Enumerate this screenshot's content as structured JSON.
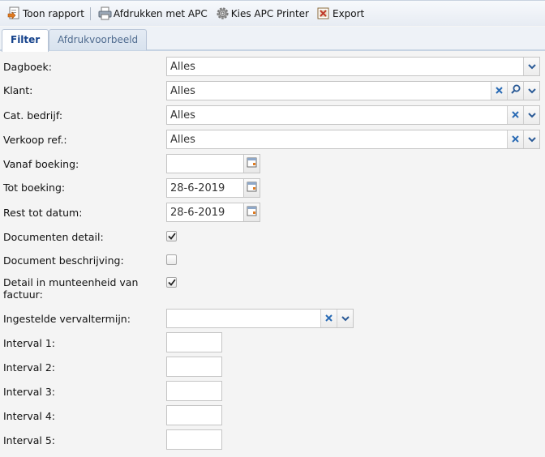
{
  "toolbar": {
    "toon_rapport": "Toon rapport",
    "afdrukken_apc": "Afdrukken met APC",
    "kies_printer": "Kies APC Printer",
    "export": "Export"
  },
  "tabs": {
    "filter": "Filter",
    "afdrukvoorbeeld": "Afdrukvoorbeeld"
  },
  "form": {
    "dagboek": {
      "label": "Dagboek:",
      "value": "Alles"
    },
    "klant": {
      "label": "Klant:",
      "value": "Alles"
    },
    "cat_bedrijf": {
      "label": "Cat. bedrijf:",
      "value": "Alles"
    },
    "verkoop_ref": {
      "label": "Verkoop ref.:",
      "value": "Alles"
    },
    "vanaf_boeking": {
      "label": "Vanaf boeking:",
      "value": ""
    },
    "tot_boeking": {
      "label": "Tot boeking:",
      "value": "28-6-2019"
    },
    "rest_tot_datum": {
      "label": "Rest tot datum:",
      "value": "28-6-2019"
    },
    "documenten_detail": {
      "label": "Documenten detail:",
      "checked": true
    },
    "document_beschrijving": {
      "label": "Document beschrijving:",
      "checked": false
    },
    "detail_munteenheid": {
      "label_line1": "Detail in munteenheid van",
      "label_line2": "factuur:",
      "checked": true
    },
    "vervaltermijn": {
      "label": "Ingestelde vervaltermijn:",
      "value": ""
    },
    "intervals": [
      {
        "label": "Interval 1:",
        "value": ""
      },
      {
        "label": "Interval 2:",
        "value": ""
      },
      {
        "label": "Interval 3:",
        "value": ""
      },
      {
        "label": "Interval 4:",
        "value": ""
      },
      {
        "label": "Interval 5:",
        "value": ""
      }
    ]
  },
  "icons": {
    "toon_rapport": "report-icon",
    "afdrukken_apc": "printer-icon",
    "kies_printer": "gear-icon",
    "export": "export-icon",
    "clear": "clear-x-icon",
    "dropdown": "chevron-down-icon",
    "search": "search-icon",
    "calendar": "calendar-icon",
    "check": "checkmark-icon"
  },
  "colors": {
    "accent": "#15428b",
    "clear_x": "#2a6bb5"
  }
}
